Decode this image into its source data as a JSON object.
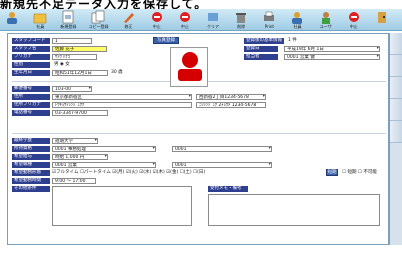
{
  "caption": "新規先不足データ入力を保存して。",
  "toolbar": {
    "buttons": [
      {
        "icon": "person-icon",
        "label": ""
      },
      {
        "icon": "folder-icon",
        "label": "社員"
      },
      {
        "icon": "new-doc-icon",
        "label": "新規登録"
      },
      {
        "icon": "copy-doc-icon",
        "label": "コピー登録"
      },
      {
        "icon": "edit-icon",
        "label": "修正"
      },
      {
        "icon": "stop-icon",
        "label": "中止"
      },
      {
        "icon": "stop-icon",
        "label": "中止"
      },
      {
        "icon": "clear-icon",
        "label": "クリア"
      },
      {
        "icon": "delete-icon",
        "label": "削除"
      },
      {
        "icon": "print-icon",
        "label": "Print"
      },
      {
        "icon": "person-icon",
        "label": "社員"
      },
      {
        "icon": "user-icon",
        "label": "ユーザ"
      },
      {
        "icon": "stop-icon",
        "label": "中止"
      },
      {
        "icon": "exit-icon",
        "label": ""
      }
    ]
  },
  "form": {
    "staff_code_label": "スタッフコード",
    "staff_code": "1",
    "staff_name_label": "スタッフ名",
    "staff_name": "佐藤 花子",
    "furigana_label": "フリガナ",
    "furigana": "ｻﾄｳ ﾊﾅｺ",
    "gender_label": "性別",
    "gender": "男 ◉ 女",
    "birth_label": "生年月日",
    "birth": "昭和51年12月1日",
    "age": "30 歳",
    "photo_button": "写真登録",
    "reg_label": "登録後の基本情報",
    "reg_value": "1 件",
    "entry_date_label": "登録日",
    "entry_date": "平成19年 6月 1日",
    "manager_label": "担当者",
    "manager": "0001 営業 健",
    "zip_label": "郵便番号",
    "zip": "103-00",
    "address_label": "住所",
    "address": "東京都新宿区",
    "address2": "西新宿2丁目1234-5678",
    "address_kana_label": "住所フリガナ",
    "address_kana": "ﾄｳｷｮｳﾄｼﾝｼﾞｭｸｸ",
    "address_kana2": "ﾆｼｼﾝｼﾞｭｸ 2ﾁｮｳﾒ 1234-5678",
    "phone_label": "電話番号",
    "phone": "03-3347-9700",
    "education_label": "最終学歴",
    "education": "短期大学",
    "skill_label": "所持資格",
    "skill": "0001 事務処理",
    "skill2": "0001",
    "pay_label": "希望給与",
    "pay": "時給 1,000 円",
    "job_label": "希望職種",
    "job": "0001 営業",
    "job2": "0001",
    "type_label": "希望勤務形態",
    "type": "☑フルタイム ☐パートタイム ☑(月) ☑(火) ☑(水) ☑(木) ☑(金) ☐(土) ☐(日)",
    "hours_label": "希望勤務時間",
    "hours": "9:00 ～ 17:00",
    "other_label": "その他条件",
    "memo_label": "受付メモ・備考",
    "short_label": "短期",
    "never_label": "不可能"
  },
  "colors": {
    "label_bg": "#2f3f8f",
    "highlight": "#ffff66",
    "toolbar": "#9fcbe4"
  }
}
